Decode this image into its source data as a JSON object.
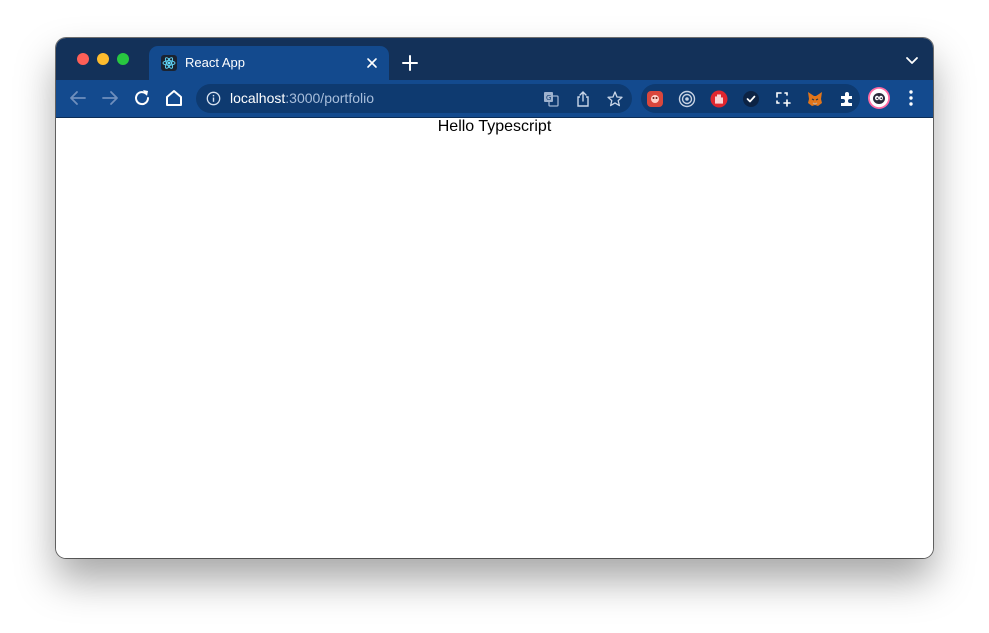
{
  "browser": {
    "tab": {
      "title": "React App",
      "favicon": "react-logo-icon"
    },
    "toolbar": {
      "back": "arrow-left-icon",
      "forward": "arrow-right-icon",
      "reload": "reload-icon",
      "home": "home-icon"
    },
    "address_bar": {
      "host": "localhost",
      "path": ":3000/portfolio",
      "site_info": "info-icon",
      "actions": [
        "translate-icon",
        "share-icon",
        "bookmark-star-icon"
      ]
    },
    "extensions": [
      "red-extension-icon",
      "target-extension-icon",
      "stop-hand-extension-icon",
      "check-extension-icon",
      "screenshot-extension-icon",
      "metamask-fox-icon",
      "puzzle-extensions-icon"
    ],
    "profile": "profile-avatar-icon",
    "menu": "kebab-menu-icon"
  },
  "page": {
    "text": "Hello Typescript"
  },
  "colors": {
    "tabbar": "#133159",
    "toolbar": "#134a8e",
    "omnibox": "#0e3a70",
    "url_host": "#ffffff",
    "url_path": "#a8bedb"
  }
}
